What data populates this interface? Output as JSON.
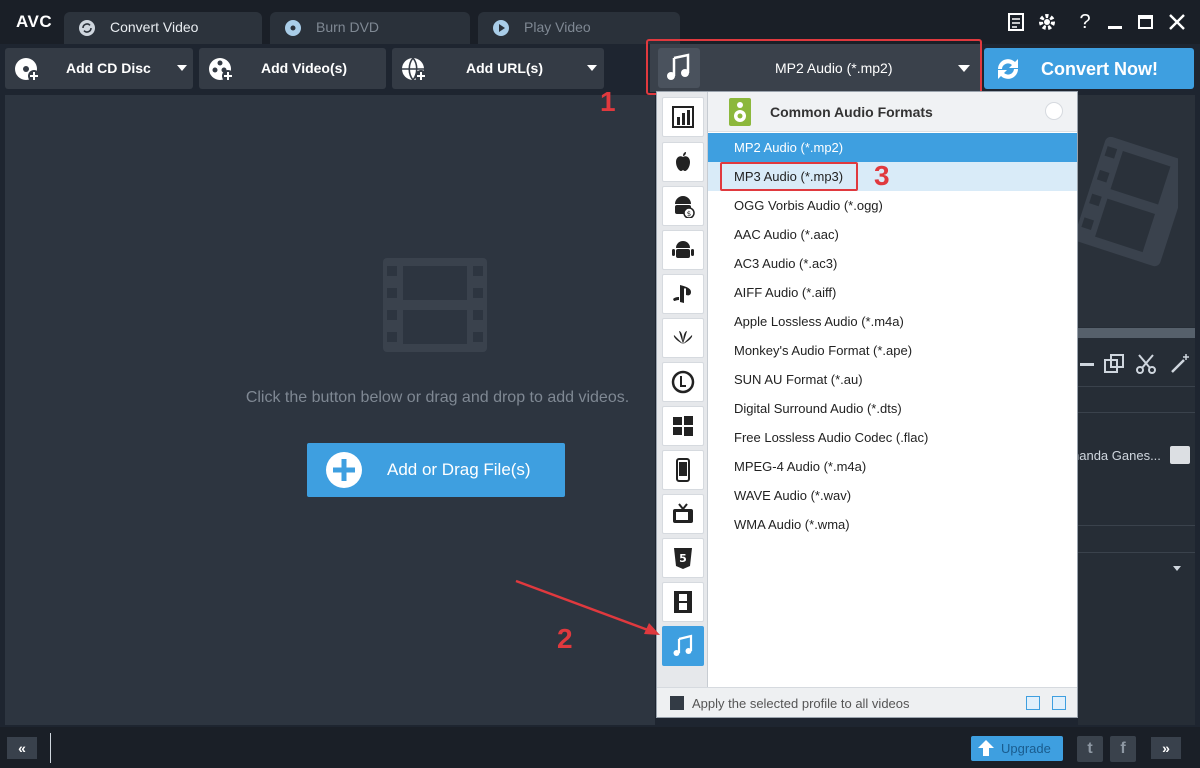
{
  "app": {
    "logo": "AVC",
    "tabs": [
      {
        "label": "Convert Video",
        "icon": "refresh-icon",
        "active": true
      },
      {
        "label": "Burn DVD",
        "icon": "disc-icon",
        "active": false
      },
      {
        "label": "Play Video",
        "icon": "play-icon",
        "active": false
      }
    ],
    "window_controls": {
      "help": "?"
    }
  },
  "toolbar": {
    "add_cd": "Add CD Disc",
    "add_video": "Add Video(s)",
    "add_url": "Add URL(s)",
    "format_selected": "MP2 Audio (*.mp2)",
    "convert": "Convert Now!"
  },
  "main": {
    "hint": "Click the button below or drag and drop to add videos.",
    "add_file": "Add or Drag File(s)"
  },
  "side_panel": {
    "output_name": "nanda Ganes..."
  },
  "dropdown": {
    "group_title": "Common Audio Formats",
    "categories": [
      "all-formats-icon",
      "apple-icon",
      "android-s-icon",
      "android-icon",
      "playstation-icon",
      "huawei-icon",
      "lg-icon",
      "windows-icon",
      "mobile-phone-icon",
      "tv-icon",
      "html5-icon",
      "film-icon",
      "music-note-icon"
    ],
    "formats": [
      "MP2 Audio (*.mp2)",
      "MP3 Audio (*.mp3)",
      "OGG Vorbis Audio (*.ogg)",
      "AAC Audio (*.aac)",
      "AC3 Audio (*.ac3)",
      "AIFF Audio (*.aiff)",
      "Apple Lossless Audio (*.m4a)",
      "Monkey's Audio Format (*.ape)",
      "SUN AU Format (*.au)",
      "Digital Surround Audio (*.dts)",
      "Free Lossless Audio Codec (.flac)",
      "MPEG-4 Audio (*.m4a)",
      "WAVE Audio (*.wav)",
      "WMA Audio (*.wma)"
    ],
    "apply_all": "Apply the selected profile to all videos"
  },
  "annotations": {
    "one": "1",
    "two": "2",
    "three": "3"
  },
  "bottom": {
    "collapse": "«",
    "expand": "»",
    "upgrade": "Upgrade",
    "twitter": "t",
    "facebook": "f"
  },
  "colors": {
    "accent": "#3e9fe0",
    "annotation": "#e0393e",
    "background": "#1e2530"
  }
}
